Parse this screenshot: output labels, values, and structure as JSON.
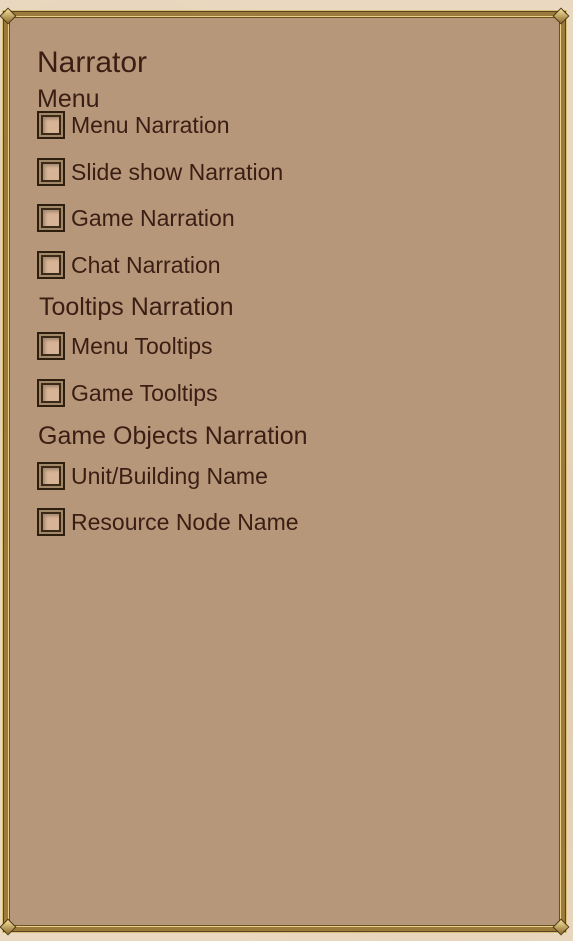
{
  "panel": {
    "title": "Narrator"
  },
  "sections": {
    "menu": {
      "heading": "Menu",
      "options": [
        {
          "label": "Menu Narration",
          "checked": false
        },
        {
          "label": "Slide show Narration",
          "checked": false
        },
        {
          "label": "Game Narration",
          "checked": false
        },
        {
          "label": "Chat Narration",
          "checked": false
        }
      ]
    },
    "tooltips": {
      "heading": "Tooltips Narration",
      "options": [
        {
          "label": "Menu Tooltips",
          "checked": false
        },
        {
          "label": "Game Tooltips",
          "checked": false
        }
      ]
    },
    "game_objects": {
      "heading": "Game Objects Narration",
      "options": [
        {
          "label": "Unit/Building Name",
          "checked": false
        },
        {
          "label": "Resource Node Name",
          "checked": false
        }
      ]
    }
  },
  "colors": {
    "panel_background": "#b79779",
    "text": "#3a1e14",
    "frame_gold": "#9b7a3c"
  }
}
